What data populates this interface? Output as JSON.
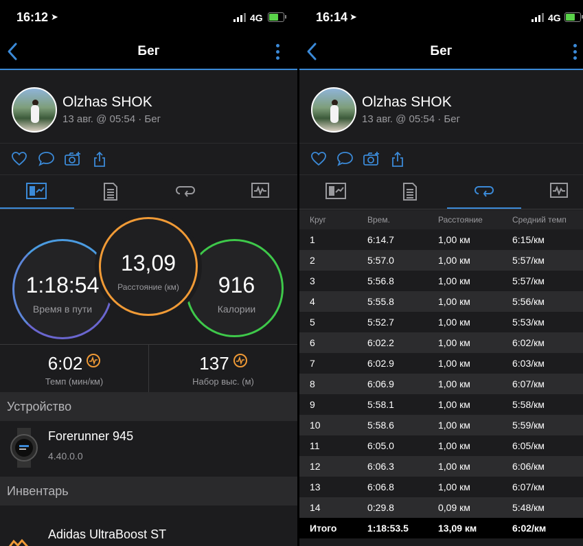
{
  "left": {
    "status": {
      "time": "16:12",
      "network": "4G"
    },
    "nav": {
      "title": "Бег"
    },
    "profile": {
      "name": "Olzhas SHOK",
      "meta": "13 авг. @ 05:54 · Бег"
    },
    "summary": {
      "duration": {
        "value": "1:18:54",
        "label": "Время в пути"
      },
      "distance": {
        "value": "13,09",
        "label": "Расстояние (км)"
      },
      "calories": {
        "value": "916",
        "label": "Калории"
      }
    },
    "stats": [
      {
        "value": "6:02",
        "label": "Темп (мин/км)"
      },
      {
        "value": "137",
        "label": "Набор выс. (м)"
      }
    ],
    "device_section": "Устройство",
    "device": {
      "name": "Forerunner 945",
      "version": "4.40.0.0"
    },
    "gear_section": "Инвентарь",
    "gear": {
      "name": "Adidas UltraBoost ST"
    }
  },
  "right": {
    "status": {
      "time": "16:14",
      "network": "4G"
    },
    "nav": {
      "title": "Бег"
    },
    "profile": {
      "name": "Olzhas SHOK",
      "meta": "13 авг. @ 05:54 · Бег"
    },
    "laps": {
      "headers": [
        "Круг",
        "Врем.",
        "Расстояние",
        "Средний темп"
      ],
      "rows": [
        [
          "1",
          "6:14.7",
          "1,00 км",
          "6:15/км"
        ],
        [
          "2",
          "5:57.0",
          "1,00 км",
          "5:57/км"
        ],
        [
          "3",
          "5:56.8",
          "1,00 км",
          "5:57/км"
        ],
        [
          "4",
          "5:55.8",
          "1,00 км",
          "5:56/км"
        ],
        [
          "5",
          "5:52.7",
          "1,00 км",
          "5:53/км"
        ],
        [
          "6",
          "6:02.2",
          "1,00 км",
          "6:02/км"
        ],
        [
          "7",
          "6:02.9",
          "1,00 км",
          "6:03/км"
        ],
        [
          "8",
          "6:06.9",
          "1,00 км",
          "6:07/км"
        ],
        [
          "9",
          "5:58.1",
          "1,00 км",
          "5:58/км"
        ],
        [
          "10",
          "5:58.6",
          "1,00 км",
          "5:59/км"
        ],
        [
          "11",
          "6:05.0",
          "1,00 км",
          "6:05/км"
        ],
        [
          "12",
          "6:06.3",
          "1,00 км",
          "6:06/км"
        ],
        [
          "13",
          "6:06.8",
          "1,00 км",
          "6:07/км"
        ],
        [
          "14",
          "0:29.8",
          "0,09 км",
          "5:48/км"
        ]
      ],
      "total": [
        "Итого",
        "1:18:53.5",
        "13,09 км",
        "6:02/км"
      ]
    }
  },
  "colors": {
    "accent": "#3b8ad8",
    "distance_ring": "#f09a36",
    "calories_ring": "#3ec84a",
    "time_ring": "#6a66cf",
    "battery": "#5ad34a"
  },
  "icons": {
    "actions": [
      "heart-icon",
      "comment-icon",
      "camera-icon",
      "share-icon"
    ],
    "tabs": [
      "overview-icon",
      "details-icon",
      "laps-icon",
      "charts-icon"
    ]
  }
}
